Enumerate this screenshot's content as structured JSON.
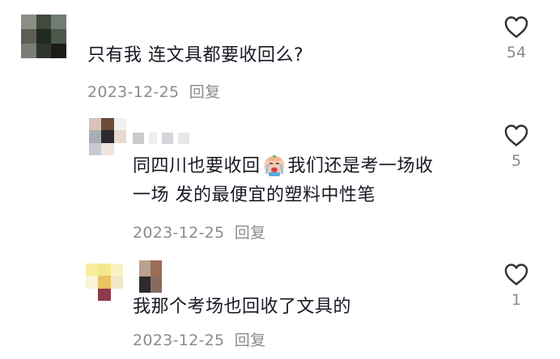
{
  "comments": [
    {
      "text": "只有我 连文具都要收回么?",
      "date": "2023-12-25",
      "reply_label": "回复",
      "likes": "54"
    },
    {
      "text_part1": "同四川也要收回",
      "text_part2": "我们还是考一场收",
      "text_line2": "一场 发的最便宜的塑料中性笔",
      "date": "2023-12-25",
      "reply_label": "回复",
      "likes": "5"
    },
    {
      "text": "我那个考场也回收了文具的",
      "date": "2023-12-25",
      "reply_label": "回复",
      "likes": "1"
    }
  ],
  "colors": {
    "text": "#161823",
    "meta": "#8a8b91",
    "icon": "#2f3035"
  },
  "icons": {
    "like": "heart-outline-icon",
    "emoji": "crying-face-emoji-icon"
  }
}
